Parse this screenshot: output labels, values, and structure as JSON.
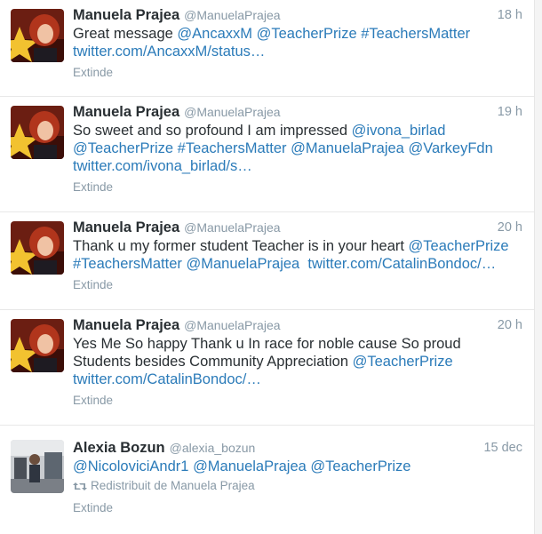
{
  "tweets": [
    {
      "name": "Manuela Prajea",
      "handle": "@ManuelaPrajea",
      "time": "18 h",
      "lines": [
        [
          {
            "t": "Great message "
          },
          {
            "t": "@AncaxxM",
            "link": true
          },
          {
            "t": " "
          },
          {
            "t": "@TeacherPrize",
            "link": true
          },
          {
            "t": " "
          },
          {
            "t": "#TeachersMatter",
            "link": true
          }
        ],
        [
          {
            "t": "twitter.com/AncaxxM/status…",
            "link": true
          }
        ]
      ],
      "expand": "Extinde"
    },
    {
      "name": "Manuela Prajea",
      "handle": "@ManuelaPrajea",
      "time": "19 h",
      "lines": [
        [
          {
            "t": "So sweet and so profound I am impressed "
          },
          {
            "t": "@ivona_birlad",
            "link": true
          }
        ],
        [
          {
            "t": "@TeacherPrize",
            "link": true
          },
          {
            "t": " "
          },
          {
            "t": "#TeachersMatter",
            "link": true
          },
          {
            "t": " "
          },
          {
            "t": "@ManuelaPrajea",
            "link": true
          },
          {
            "t": " "
          },
          {
            "t": "@VarkeyFdn",
            "link": true
          }
        ],
        [
          {
            "t": "twitter.com/ivona_birlad/s…",
            "link": true
          }
        ]
      ],
      "expand": "Extinde"
    },
    {
      "name": "Manuela Prajea",
      "handle": "@ManuelaPrajea",
      "time": "20 h",
      "lines": [
        [
          {
            "t": "Thank u my former student Teacher is in your heart "
          },
          {
            "t": "@TeacherPrize",
            "link": true
          }
        ],
        [
          {
            "t": "#TeachersMatter",
            "link": true
          },
          {
            "t": " "
          },
          {
            "t": "@ManuelaPrajea",
            "link": true
          },
          {
            "t": "  "
          },
          {
            "t": "twitter.com/CatalinBondoc/…",
            "link": true
          }
        ]
      ],
      "expand": "Extinde"
    },
    {
      "name": "Manuela Prajea",
      "handle": "@ManuelaPrajea",
      "time": "20 h",
      "lines": [
        [
          {
            "t": "Yes Me So happy Thank u In race for noble cause So proud"
          }
        ],
        [
          {
            "t": "Students besides Community Appreciation "
          },
          {
            "t": "@TeacherPrize",
            "link": true
          }
        ],
        [
          {
            "t": "twitter.com/CatalinBondoc/…",
            "link": true
          }
        ]
      ],
      "expand": "Extinde"
    },
    {
      "name": "Alexia Bozun",
      "handle": "@alexia_bozun",
      "time": "15 dec",
      "lines": [
        [
          {
            "t": "@NicoloviciAndr1",
            "link": true
          },
          {
            "t": " "
          },
          {
            "t": "@ManuelaPrajea",
            "link": true
          },
          {
            "t": " "
          },
          {
            "t": "@TeacherPrize",
            "link": true
          }
        ]
      ],
      "retweet": "Redistribuit de Manuela Prajea",
      "expand": "Extinde"
    }
  ],
  "icons": {
    "avatar_manuela": "profile-photo-star",
    "avatar_alexia": "profile-photo-room",
    "retweet": "retweet-icon"
  },
  "colors": {
    "link": "#2b7bb9",
    "muted": "#8899a6",
    "text": "#292f33"
  }
}
